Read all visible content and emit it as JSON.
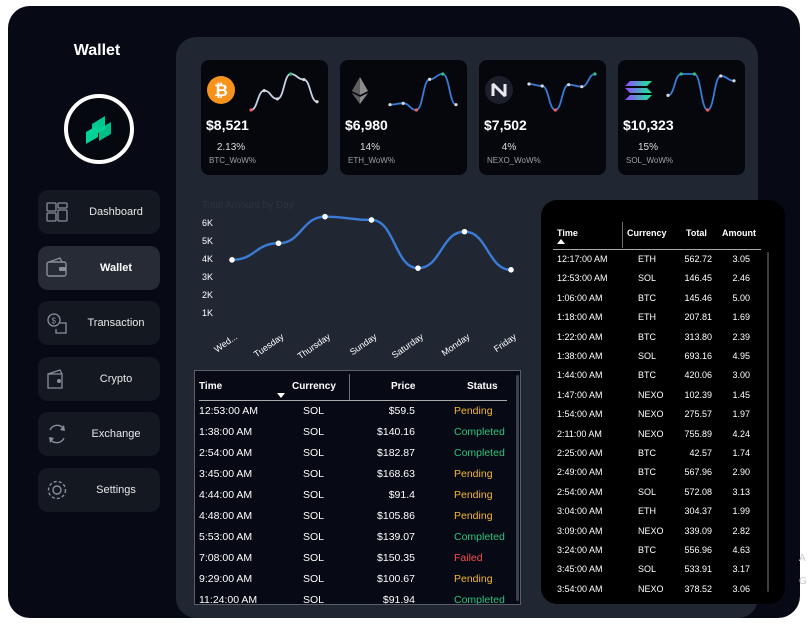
{
  "sidebar": {
    "title": "Wallet",
    "items": [
      {
        "label": "Dashboard",
        "icon": "dashboard-icon",
        "active": false
      },
      {
        "label": "Wallet",
        "icon": "wallet-icon",
        "active": true
      },
      {
        "label": "Transaction",
        "icon": "transaction-icon",
        "active": false
      },
      {
        "label": "Crypto",
        "icon": "crypto-icon",
        "active": false
      },
      {
        "label": "Exchange",
        "icon": "exchange-icon",
        "active": false
      },
      {
        "label": "Settings",
        "icon": "settings-icon",
        "active": false
      }
    ]
  },
  "cards": [
    {
      "coin": "BTC",
      "icon": "bitcoin-icon",
      "price": "$8,521",
      "change": "2.13%",
      "label": "BTC_WoW%",
      "spark": [
        2,
        5.5,
        4,
        8.5,
        7.5,
        3.5
      ]
    },
    {
      "coin": "ETH",
      "icon": "ethereum-icon",
      "price": "$6,980",
      "change": "14%",
      "label": "ETH_WoW%",
      "spark": [
        3,
        3.2,
        2.2,
        6.8,
        7.6,
        3
      ]
    },
    {
      "coin": "NEXO",
      "icon": "nexo-icon",
      "price": "$7,502",
      "change": "4%",
      "label": "NEXO_WoW%",
      "spark": [
        6.5,
        6.2,
        2.6,
        6.4,
        6.1,
        8
      ]
    },
    {
      "coin": "SOL",
      "icon": "solana-icon",
      "price": "$10,323",
      "change": "15%",
      "label": "SOL_WoW%",
      "spark": [
        4,
        6.2,
        6.2,
        2.5,
        6,
        5.5
      ]
    }
  ],
  "daily_chart": {
    "title": "Total Amount by Day",
    "yticks": [
      "6K",
      "5K",
      "4K",
      "3K",
      "2K",
      "1K"
    ]
  },
  "chart_data": {
    "type": "line",
    "title": "Total Amount by Day",
    "categories": [
      "Wed...",
      "Tuesday",
      "Thursday",
      "Sunday",
      "Saturday",
      "Monday",
      "Friday"
    ],
    "values": [
      3800,
      4800,
      6400,
      6200,
      3300,
      5500,
      3200
    ],
    "ylim": [
      0,
      6500
    ],
    "grid": false,
    "color": "#3a7bd5"
  },
  "orders_table": {
    "headers": {
      "time": "Time",
      "currency": "Currency",
      "price": "Price",
      "status": "Status"
    },
    "rows": [
      {
        "time": "12:53:00 AM",
        "currency": "SOL",
        "price": "$59.5",
        "status": "Pending"
      },
      {
        "time": "1:38:00 AM",
        "currency": "SOL",
        "price": "$140.16",
        "status": "Completed"
      },
      {
        "time": "2:54:00 AM",
        "currency": "SOL",
        "price": "$182.87",
        "status": "Completed"
      },
      {
        "time": "3:45:00 AM",
        "currency": "SOL",
        "price": "$168.63",
        "status": "Pending"
      },
      {
        "time": "4:44:00 AM",
        "currency": "SOL",
        "price": "$91.4",
        "status": "Pending"
      },
      {
        "time": "4:48:00 AM",
        "currency": "SOL",
        "price": "$105.86",
        "status": "Pending"
      },
      {
        "time": "5:53:00 AM",
        "currency": "SOL",
        "price": "$139.07",
        "status": "Completed"
      },
      {
        "time": "7:08:00 AM",
        "currency": "SOL",
        "price": "$150.35",
        "status": "Failed"
      },
      {
        "time": "9:29:00 AM",
        "currency": "SOL",
        "price": "$100.67",
        "status": "Pending"
      },
      {
        "time": "11:24:00 AM",
        "currency": "SOL",
        "price": "$91.94",
        "status": "Completed"
      }
    ]
  },
  "trades_table": {
    "headers": {
      "time": "Time",
      "currency": "Currency",
      "total": "Total",
      "amount": "Amount"
    },
    "rows": [
      {
        "time": "12:17:00 AM",
        "currency": "ETH",
        "total": "562.72",
        "amount": "3.05"
      },
      {
        "time": "12:53:00 AM",
        "currency": "SOL",
        "total": "146.45",
        "amount": "2.46"
      },
      {
        "time": "1:06:00 AM",
        "currency": "BTC",
        "total": "145.46",
        "amount": "5.00"
      },
      {
        "time": "1:18:00 AM",
        "currency": "ETH",
        "total": "207.81",
        "amount": "1.69"
      },
      {
        "time": "1:22:00 AM",
        "currency": "BTC",
        "total": "313.80",
        "amount": "2.39"
      },
      {
        "time": "1:38:00 AM",
        "currency": "SOL",
        "total": "693.16",
        "amount": "4.95"
      },
      {
        "time": "1:44:00 AM",
        "currency": "BTC",
        "total": "420.06",
        "amount": "3.00"
      },
      {
        "time": "1:47:00 AM",
        "currency": "NEXO",
        "total": "102.39",
        "amount": "1.45"
      },
      {
        "time": "1:54:00 AM",
        "currency": "NEXO",
        "total": "275.57",
        "amount": "1.97"
      },
      {
        "time": "2:11:00 AM",
        "currency": "NEXO",
        "total": "755.89",
        "amount": "4.24"
      },
      {
        "time": "2:25:00 AM",
        "currency": "BTC",
        "total": "42.57",
        "amount": "1.74"
      },
      {
        "time": "2:49:00 AM",
        "currency": "BTC",
        "total": "567.96",
        "amount": "2.90"
      },
      {
        "time": "2:54:00 AM",
        "currency": "SOL",
        "total": "572.08",
        "amount": "3.13"
      },
      {
        "time": "3:04:00 AM",
        "currency": "ETH",
        "total": "304.37",
        "amount": "1.99"
      },
      {
        "time": "3:09:00 AM",
        "currency": "NEXO",
        "total": "339.09",
        "amount": "2.82"
      },
      {
        "time": "3:24:00 AM",
        "currency": "BTC",
        "total": "556.96",
        "amount": "4.63"
      },
      {
        "time": "3:45:00 AM",
        "currency": "SOL",
        "total": "533.91",
        "amount": "3.17"
      },
      {
        "time": "3:54:00 AM",
        "currency": "NEXO",
        "total": "378.52",
        "amount": "3.06"
      }
    ]
  },
  "status_colors": {
    "Pending": "#f5b731",
    "Completed": "#2ec27e",
    "Failed": "#ff4d4f"
  },
  "edge_text": [
    "A",
    "G"
  ]
}
